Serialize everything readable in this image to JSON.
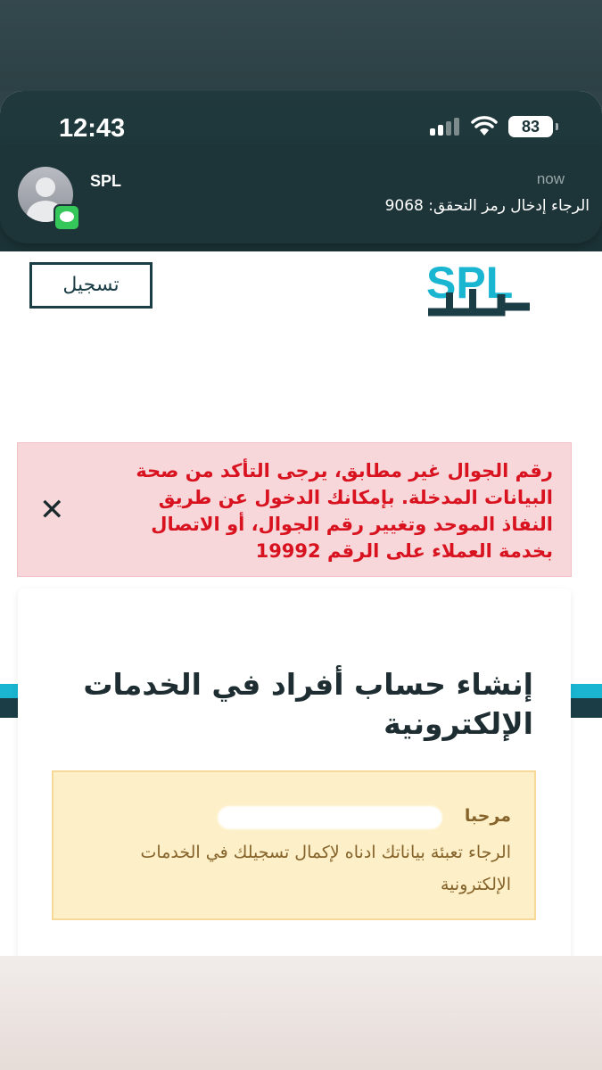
{
  "status_bar": {
    "time": "12:43",
    "battery": "83"
  },
  "notification": {
    "app": "SPL",
    "time": "now",
    "body": "الرجاء إدخال رمز التحقق: 9068"
  },
  "header": {
    "register_label": "تسجيل",
    "logo_text": "SPL"
  },
  "alert": {
    "message": "رقم الجوال غير مطابق، يرجى التأكد من صحة البيانات المدخلة. بإمكانك الدخول عن طريق النفاذ الموحد وتغيير رقم الجوال، أو الاتصال بخدمة العملاء على الرقم 19992",
    "close_symbol": "✕"
  },
  "card": {
    "title": "إنشاء حساب أفراد في الخدمات الإلكترونية",
    "greeting": "مرحبا",
    "instructions": "الرجاء تعبئة بياناتك ادناه لإكمال تسجيلك في الخدمات الإلكترونية"
  },
  "colors": {
    "brand_dark": "#1b3e46",
    "brand_cyan": "#19b5d1",
    "alert_bg": "#f8d7da",
    "alert_text": "#d8121f",
    "info_bg": "#fdefc7",
    "info_text": "#85632a"
  }
}
